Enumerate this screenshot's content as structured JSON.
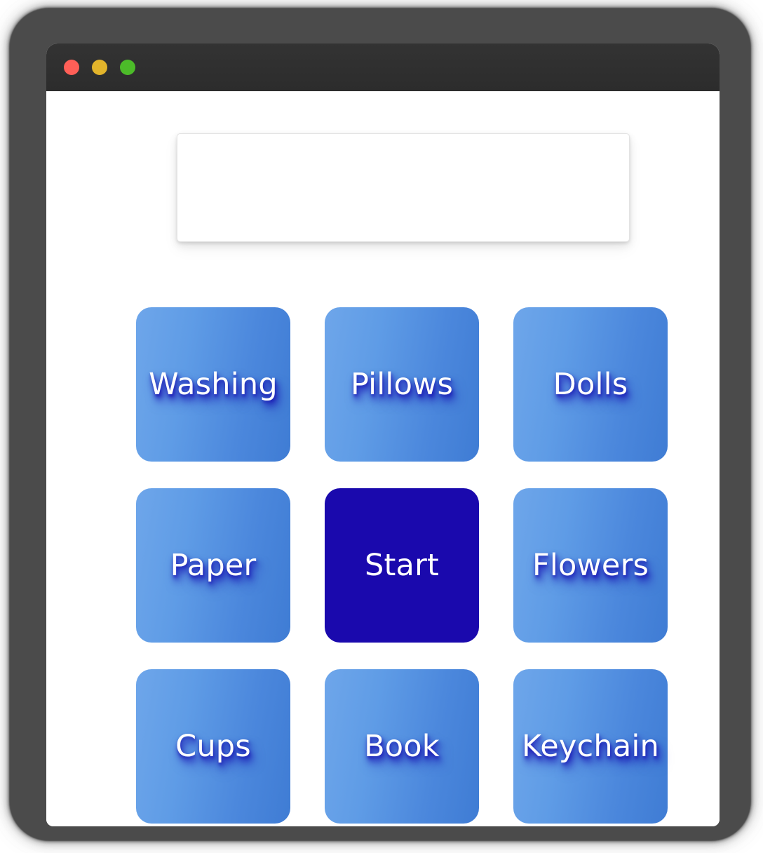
{
  "window": {
    "title_bar": {
      "controls": [
        {
          "name": "close-button",
          "icon": "close-traffic-light",
          "color": "#ff5f57"
        },
        {
          "name": "minimize-button",
          "icon": "minimize-traffic-light",
          "color": "#e2b42b"
        },
        {
          "name": "maximize-button",
          "icon": "maximize-traffic-light",
          "color": "#4cbb29"
        }
      ]
    }
  },
  "display": {
    "value": "",
    "placeholder": ""
  },
  "keypad": {
    "accent_color": "#1a09ad",
    "tile_gradient_from": "#6ea6ea",
    "tile_gradient_to": "#3f7cd4",
    "tiles": [
      {
        "label": "Washing",
        "name": "tile-washing",
        "accent": false
      },
      {
        "label": "Pillows",
        "name": "tile-pillows",
        "accent": false
      },
      {
        "label": "Dolls",
        "name": "tile-dolls",
        "accent": false
      },
      {
        "label": "Paper",
        "name": "tile-paper",
        "accent": false
      },
      {
        "label": "Start",
        "name": "tile-start",
        "accent": true
      },
      {
        "label": "Flowers",
        "name": "tile-flowers",
        "accent": false
      },
      {
        "label": "Cups",
        "name": "tile-cups",
        "accent": false
      },
      {
        "label": "Book",
        "name": "tile-book",
        "accent": false
      },
      {
        "label": "Keychain",
        "name": "tile-keychain",
        "accent": false
      }
    ]
  }
}
